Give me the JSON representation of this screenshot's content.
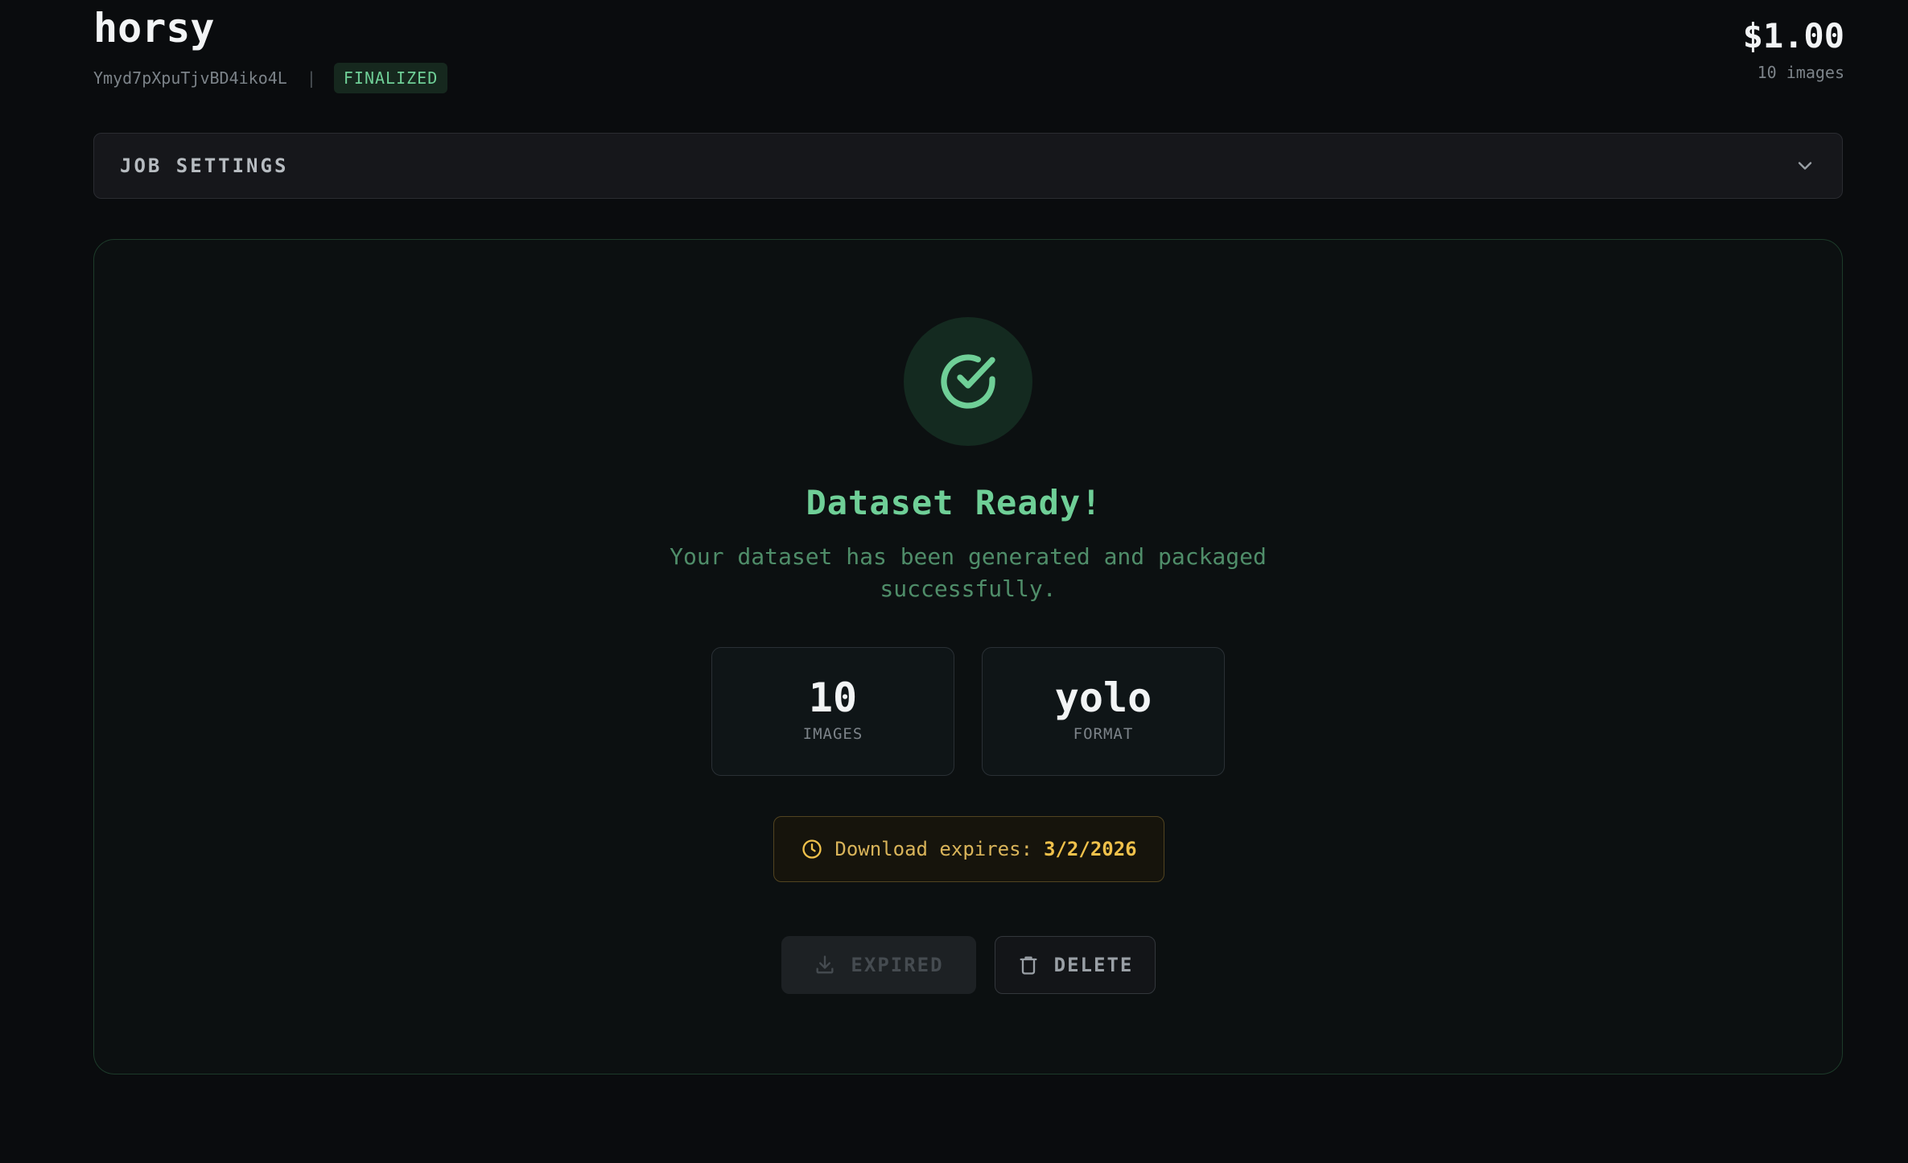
{
  "header": {
    "title": "horsy",
    "job_id": "Ymyd7pXpuTjvBD4iko4L",
    "separator": "|",
    "status": "FINALIZED",
    "price": "$1.00",
    "price_sub": "10 images"
  },
  "settings": {
    "label": "JOB SETTINGS",
    "icon": "chevron-down-icon"
  },
  "result": {
    "icon": "check-circle-icon",
    "title": "Dataset Ready!",
    "description": "Your dataset has been generated and packaged successfully.",
    "stats": [
      {
        "value": "10",
        "label": "IMAGES"
      },
      {
        "value": "yolo",
        "label": "FORMAT"
      }
    ],
    "expiry": {
      "icon": "clock-icon",
      "label": "Download expires:",
      "date": "3/2/2026"
    },
    "buttons": {
      "download_label": "EXPIRED",
      "download_icon": "download-icon",
      "delete_label": "DELETE",
      "delete_icon": "trash-icon"
    }
  },
  "colors": {
    "accent": "#6fcf97",
    "warning": "#f0c14b",
    "background": "#0a0c0e"
  }
}
